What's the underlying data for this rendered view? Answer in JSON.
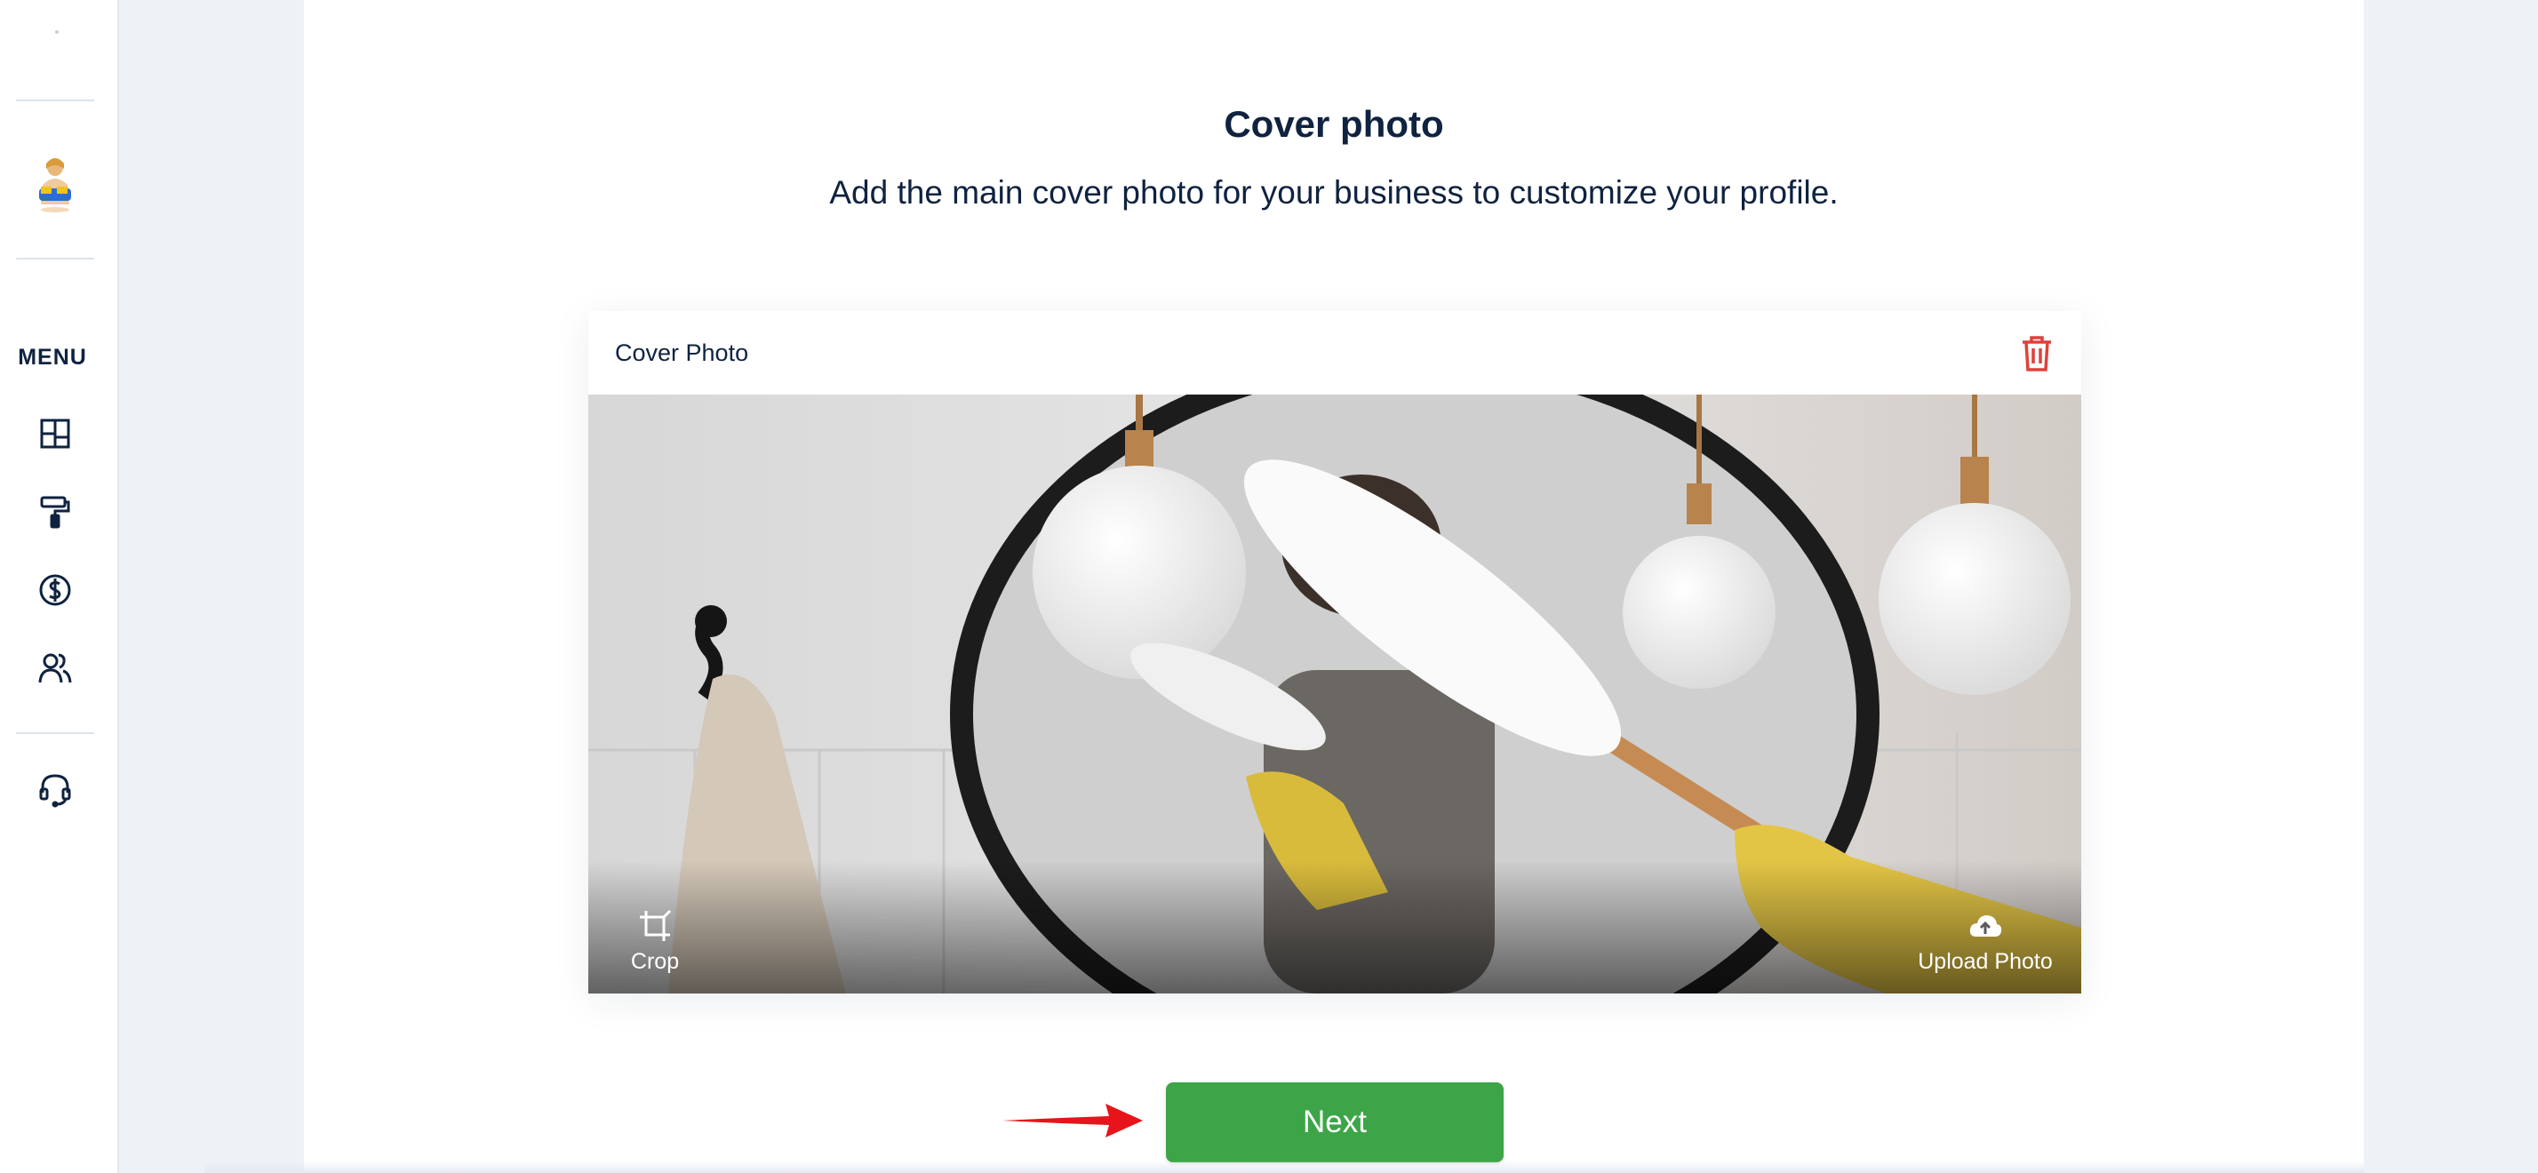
{
  "sidebar": {
    "menu_label": "MENU",
    "logo": "business-logo",
    "icons": [
      "dashboard-icon",
      "paint-roller-icon",
      "dollar-icon",
      "users-icon",
      "support-headset-icon"
    ]
  },
  "page": {
    "title": "Cover photo",
    "subtitle": "Add the main cover photo for your business to customize your profile."
  },
  "card": {
    "label": "Cover Photo",
    "delete_icon": "trash-icon",
    "crop_label": "Crop",
    "upload_label": "Upload Photo"
  },
  "actions": {
    "next_label": "Next"
  },
  "colors": {
    "accent": "#3da548",
    "danger": "#e0413b",
    "text": "#0f2240",
    "annotation_arrow": "#e8141b"
  }
}
